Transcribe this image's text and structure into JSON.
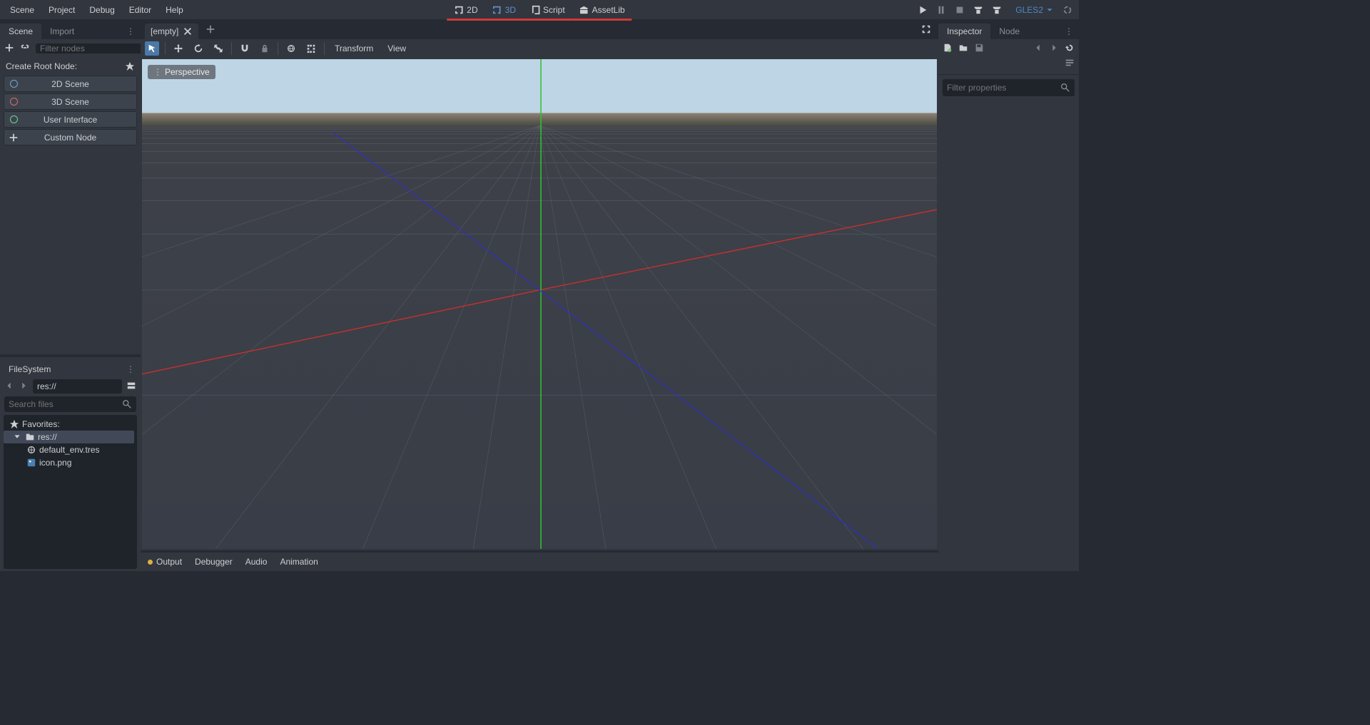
{
  "menubar": {
    "items": [
      "Scene",
      "Project",
      "Debug",
      "Editor",
      "Help"
    ],
    "workspaces": [
      {
        "label": "2D",
        "active": false,
        "underline": true
      },
      {
        "label": "3D",
        "active": true,
        "underline": true
      },
      {
        "label": "Script",
        "active": false,
        "underline": true
      },
      {
        "label": "AssetLib",
        "active": false,
        "underline": true
      }
    ],
    "renderer": "GLES2"
  },
  "left_dock": {
    "tabs": {
      "scene": "Scene",
      "import": "Import"
    },
    "filter_nodes_placeholder": "Filter nodes",
    "create_root_label": "Create Root Node:",
    "root_buttons": [
      {
        "label": "2D Scene",
        "color": "#6da8d6"
      },
      {
        "label": "3D Scene",
        "color": "#d66d6d"
      },
      {
        "label": "User Interface",
        "color": "#6dd693"
      },
      {
        "label": "Custom Node",
        "color": "#cdcfd2"
      }
    ]
  },
  "filesystem": {
    "title": "FileSystem",
    "path": "res://",
    "search_placeholder": "Search files",
    "favorites": "Favorites:",
    "tree": {
      "root": "res://",
      "files": [
        "default_env.tres",
        "icon.png"
      ]
    }
  },
  "center": {
    "tab_label": "[empty]",
    "toolbar": {
      "transform": "Transform",
      "view": "View"
    },
    "viewport": {
      "label": "Perspective"
    }
  },
  "bottom_panel": {
    "items": [
      "Output",
      "Debugger",
      "Audio",
      "Animation"
    ]
  },
  "right_dock": {
    "tabs": {
      "inspector": "Inspector",
      "node": "Node"
    },
    "filter_placeholder": "Filter properties"
  }
}
